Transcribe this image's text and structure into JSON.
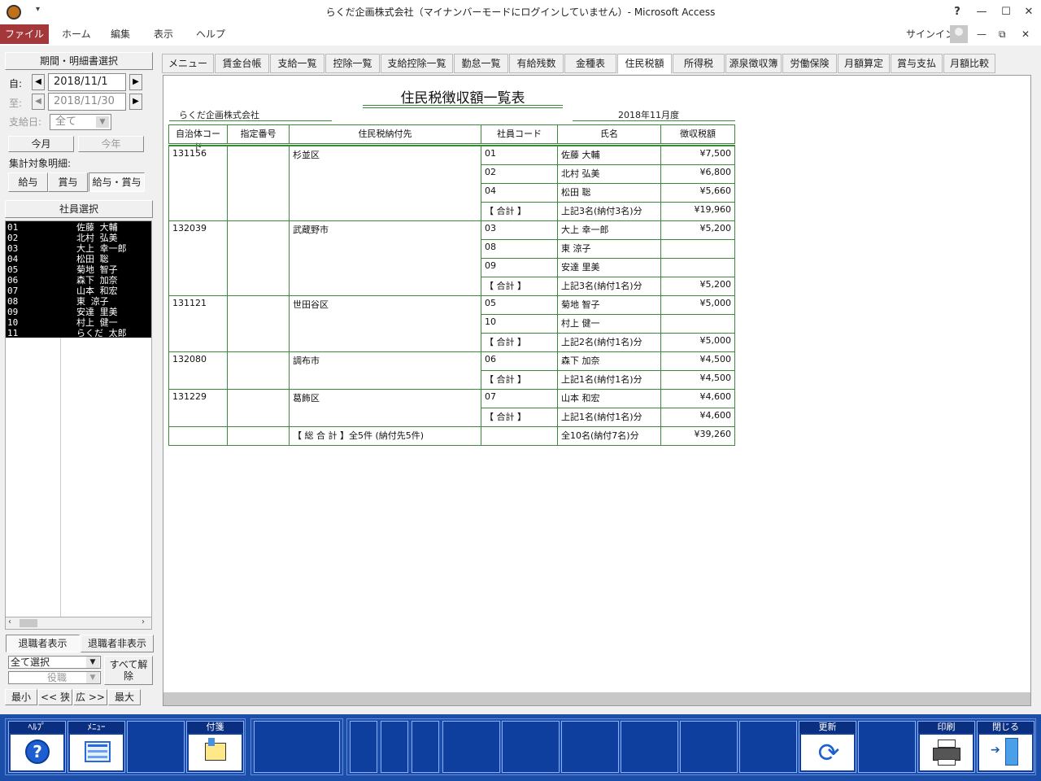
{
  "window": {
    "title": "らくだ企画株式会社（マイナンバーモードにログインしていません）- Microsoft Access",
    "qat_arrow": "▾",
    "help_btn": "?",
    "min_btn": "—",
    "max_btn": "☐",
    "close_btn": "✕"
  },
  "ribbon": {
    "file": "ファイル",
    "tabs": [
      "ホーム",
      "編集",
      "表示",
      "ヘルプ"
    ],
    "signin": "サインイン",
    "restore_min": "—",
    "restore_max": "⧉",
    "restore_close": "✕"
  },
  "left": {
    "period_button": "期間・明細書選択",
    "from_label": "自:",
    "from_value": "2018/11/1",
    "to_label": "至:",
    "to_value": "2018/11/30",
    "payday_label": "支給日:",
    "payday_value": "全て",
    "this_month": "今月",
    "this_year": "今年",
    "target_label": "集計対象明細:",
    "target_options": [
      "給与",
      "賞与",
      "給与・賞与"
    ],
    "employee_select": "社員選択",
    "employees": [
      {
        "code": "01",
        "name": "佐藤 大輔"
      },
      {
        "code": "02",
        "name": "北村 弘美"
      },
      {
        "code": "03",
        "name": "大上 幸一郎"
      },
      {
        "code": "04",
        "name": "松田 聡"
      },
      {
        "code": "05",
        "name": "菊地 智子"
      },
      {
        "code": "06",
        "name": "森下 加奈"
      },
      {
        "code": "07",
        "name": "山本 和宏"
      },
      {
        "code": "08",
        "name": "東 涼子"
      },
      {
        "code": "09",
        "name": "安達 里美"
      },
      {
        "code": "10",
        "name": "村上 健一"
      },
      {
        "code": "11",
        "name": "らくだ 太郎"
      }
    ],
    "retired_show": "退職者表示",
    "retired_hide": "退職者非表示",
    "select_all": "全て選択",
    "position": "役職",
    "clear_all": "すべて解除",
    "size_buttons": [
      "最小",
      "<< 狭",
      "広 >>",
      "最大"
    ]
  },
  "tabs": [
    "メニュー",
    "賃金台帳",
    "支給一覧",
    "控除一覧",
    "支給控除一覧",
    "勤怠一覧",
    "有給残数",
    "金種表",
    "住民税額",
    "所得税",
    "源泉徴収簿",
    "労働保険",
    "月額算定",
    "賞与支払",
    "月額比較"
  ],
  "active_tab": "住民税額",
  "report": {
    "title": "住民税徴収額一覧表",
    "company": "らくだ企画株式会社",
    "period": "2018年11月度",
    "headers": [
      "自治体コード",
      "指定番号",
      "住民税納付先",
      "社員コード",
      "氏名",
      "徴収税額"
    ],
    "groups": [
      {
        "code": "131156",
        "dest": "杉並区",
        "rows": [
          {
            "emp": "01",
            "name": "佐藤  大輔",
            "amt": "¥7,500"
          },
          {
            "emp": "02",
            "name": "北村  弘美",
            "amt": "¥6,800"
          },
          {
            "emp": "04",
            "name": "松田  聡",
            "amt": "¥5,660"
          },
          {
            "emp": "【 合計 】",
            "name": "上記3名(納付3名)分",
            "amt": "¥19,960"
          }
        ]
      },
      {
        "code": "132039",
        "dest": "武蔵野市",
        "rows": [
          {
            "emp": "03",
            "name": "大上  幸一郎",
            "amt": "¥5,200"
          },
          {
            "emp": "08",
            "name": "東  涼子",
            "amt": ""
          },
          {
            "emp": "09",
            "name": "安達  里美",
            "amt": ""
          },
          {
            "emp": "【 合計 】",
            "name": "上記3名(納付1名)分",
            "amt": "¥5,200"
          }
        ]
      },
      {
        "code": "131121",
        "dest": "世田谷区",
        "rows": [
          {
            "emp": "05",
            "name": "菊地  智子",
            "amt": "¥5,000"
          },
          {
            "emp": "10",
            "name": "村上  健一",
            "amt": ""
          },
          {
            "emp": "【 合計 】",
            "name": "上記2名(納付1名)分",
            "amt": "¥5,000"
          }
        ]
      },
      {
        "code": "132080",
        "dest": "調布市",
        "rows": [
          {
            "emp": "06",
            "name": "森下  加奈",
            "amt": "¥4,500"
          },
          {
            "emp": "【 合計 】",
            "name": "上記1名(納付1名)分",
            "amt": "¥4,500"
          }
        ]
      },
      {
        "code": "131229",
        "dest": "葛飾区",
        "rows": [
          {
            "emp": "07",
            "name": "山本  和宏",
            "amt": "¥4,600"
          },
          {
            "emp": "【 合計 】",
            "name": "上記1名(納付1名)分",
            "amt": "¥4,600"
          }
        ]
      }
    ],
    "grand_total": {
      "label": "【 総 合 計 】全5件 (納付先5件)",
      "name": "全10名(納付7名)分",
      "amt": "¥39,260"
    }
  },
  "toolbar": {
    "help": "ﾍﾙﾌﾟ",
    "help_glyph": "?",
    "menu": "ﾒﾆｭｰ",
    "sticky": "付箋",
    "refresh": "更新",
    "refresh_glyph": "⟳",
    "print": "印刷",
    "close": "閉じる"
  }
}
